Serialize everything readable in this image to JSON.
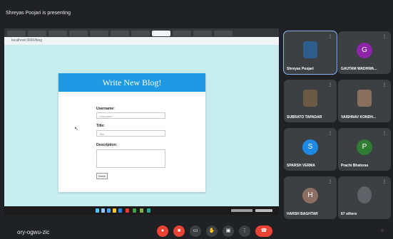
{
  "meeting": {
    "presenting_label": "Shreyas Poojari is presenting",
    "code": "ory-ogwu-zic"
  },
  "browser": {
    "address": "localhost:3000/blog"
  },
  "blog_form": {
    "title": "Write New Blog!",
    "username_label": "Username:",
    "username_placeholder": "Username",
    "title_label": "Title:",
    "title_placeholder": "Title",
    "description_label": "Description:",
    "submit_label": "Done"
  },
  "participants": [
    {
      "name": "Shreyas Poojari",
      "type": "photo",
      "color": "#2d5d8c"
    },
    {
      "name": "GAUTAM WADHWA...",
      "type": "initial",
      "initial": "G",
      "color": "#8e24aa"
    },
    {
      "name": "SUBRATO TAPADAR",
      "type": "photo",
      "color": "#6b5a44"
    },
    {
      "name": "VAISHNAV KONDH...",
      "type": "photo",
      "color": "#8a6f5c"
    },
    {
      "name": "SPARSH VERMA",
      "type": "initial",
      "initial": "S",
      "color": "#1e88e5"
    },
    {
      "name": "Prachi Bhatoras",
      "type": "initial",
      "initial": "P",
      "color": "#2e7d32"
    },
    {
      "name": "HARSH BAGHTAR",
      "type": "initial",
      "initial": "H",
      "color": "#8d6e63"
    },
    {
      "name": "67 others",
      "type": "others",
      "color": "#5f6368"
    }
  ],
  "controls": {
    "mic": "mic-off-icon",
    "camera": "camera-off-icon",
    "captions": "captions-icon",
    "hand": "raise-hand-icon",
    "present": "present-icon",
    "more": "more-icon",
    "leave": "hangup-icon"
  },
  "colors": {
    "accent": "#1e9ae3",
    "page_bg": "#c7edf1",
    "meet_bg": "#202124",
    "danger": "#ea4335"
  }
}
